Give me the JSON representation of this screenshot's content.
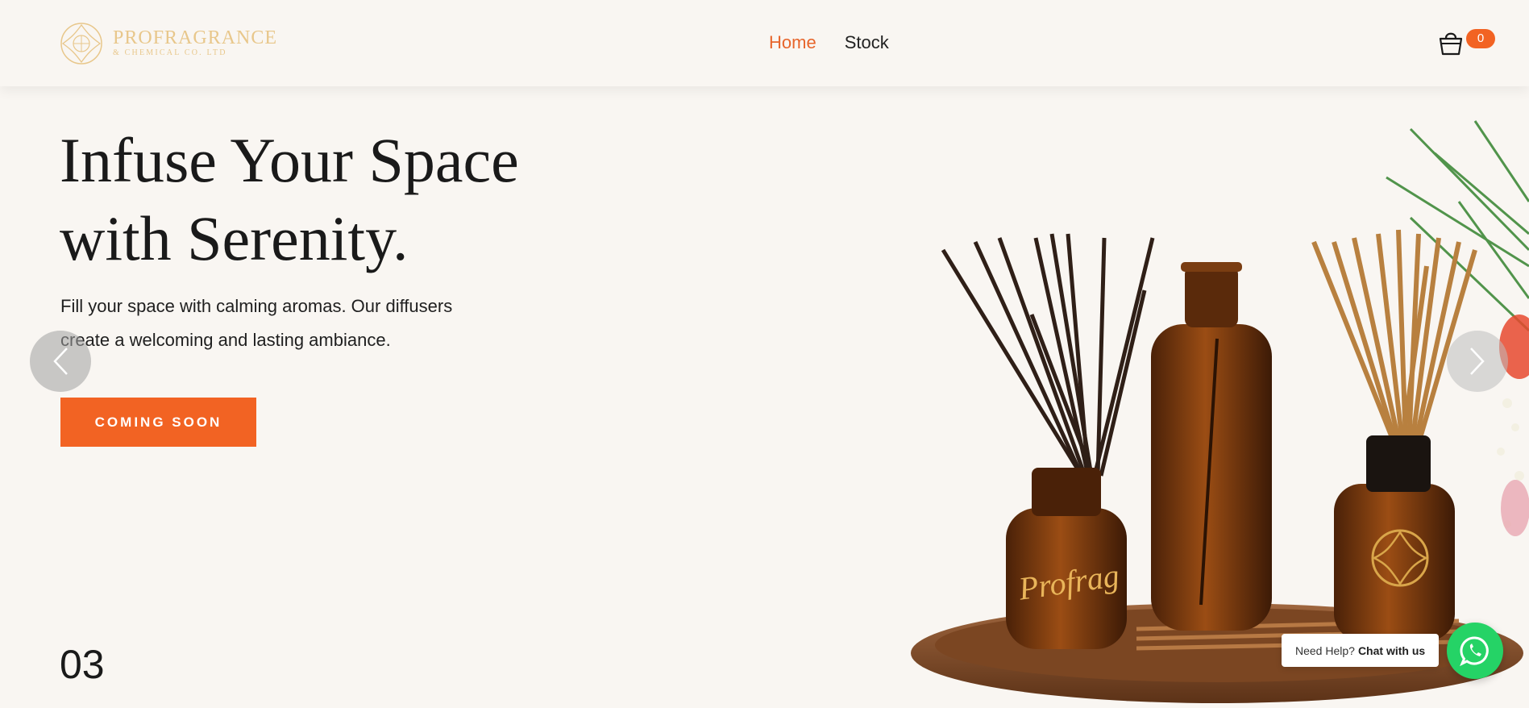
{
  "brand": {
    "name": "PROFRAGRANCE",
    "subtitle": "& CHEMICAL CO. LTD",
    "gold": "#e8c78b"
  },
  "nav": {
    "items": [
      {
        "label": "Home",
        "active": true
      },
      {
        "label": "Stock",
        "active": false
      }
    ]
  },
  "cart": {
    "count": "0",
    "icon": "basket-icon"
  },
  "hero": {
    "title_line1": "Infuse Your Space",
    "title_line2": "with Serenity.",
    "description": "Fill your space with calming aromas. Our diffusers create a welcoming and lasting ambiance.",
    "cta_label": "COMING SOON",
    "slide_number": "03",
    "bottle_label": "Profrag"
  },
  "chat": {
    "prompt": "Need Help?",
    "action": "Chat with us",
    "icon": "whatsapp-icon"
  },
  "colors": {
    "accent": "#f26323",
    "background": "#f9f6f2",
    "whatsapp": "#25d366"
  }
}
